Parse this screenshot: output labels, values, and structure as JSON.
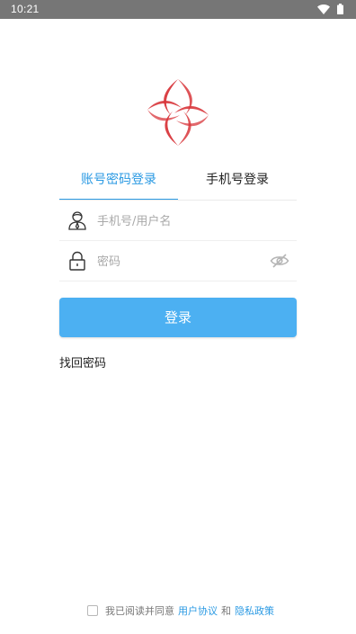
{
  "status_bar": {
    "time": "10:21"
  },
  "tabs": [
    {
      "label": "账号密码登录",
      "active": true
    },
    {
      "label": "手机号登录",
      "active": false
    }
  ],
  "form": {
    "username_placeholder": "手机号/用户名",
    "username_value": "",
    "password_placeholder": "密码",
    "password_value": ""
  },
  "login_button": {
    "label": "登录"
  },
  "forgot_password": {
    "label": "找回密码"
  },
  "agreement": {
    "checked": false,
    "prefix": "我已阅读并同意",
    "user_agreement": "用户协议",
    "and": "和",
    "privacy_policy": "隐私政策"
  },
  "colors": {
    "accent": "#2b9ae3",
    "button": "#4cb0f2",
    "logo_red": "#d8363b",
    "status_bar": "#767676"
  },
  "icons": [
    "wifi-icon",
    "battery-icon",
    "app-logo",
    "user-icon",
    "lock-icon",
    "eye-hidden-icon",
    "checkbox"
  ]
}
